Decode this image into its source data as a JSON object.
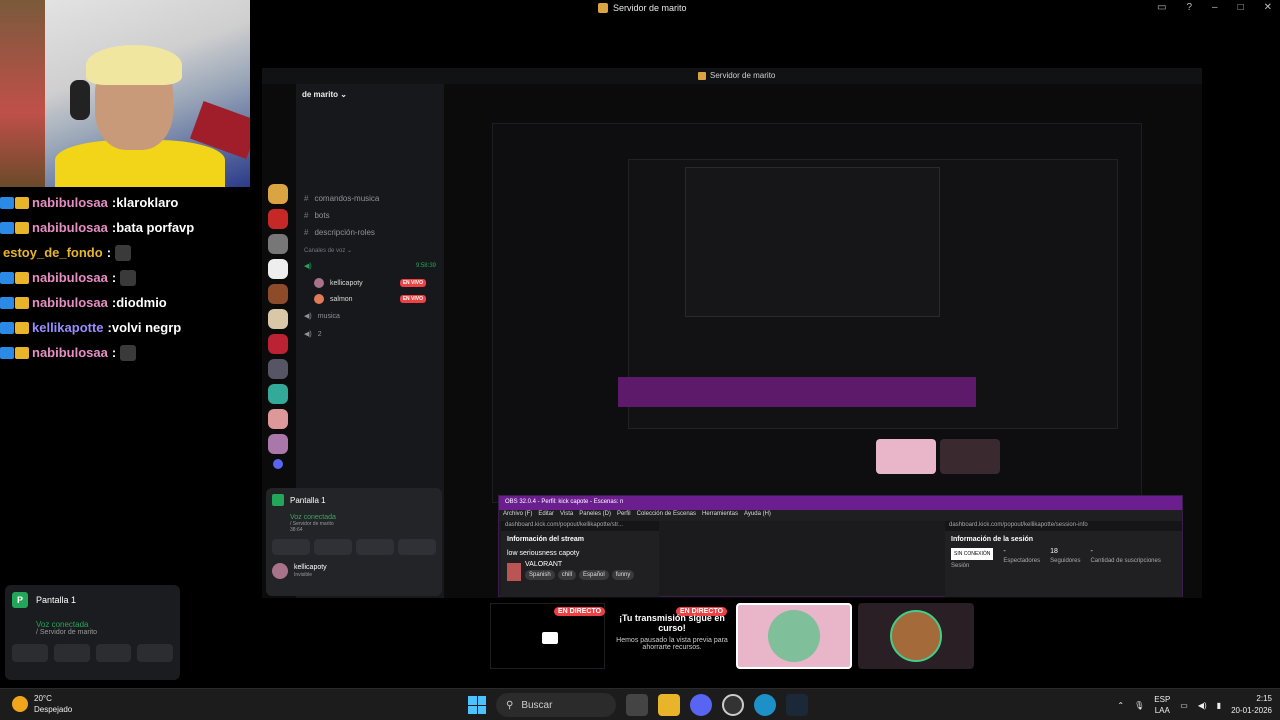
{
  "window": {
    "title": "Servidor de marito"
  },
  "chat": [
    {
      "user": "nabibulosaa",
      "color": "#e88ec4",
      "msg": "klaroklaro",
      "badges": [
        "mod",
        "crown"
      ]
    },
    {
      "user": "nabibulosaa",
      "color": "#e88ec4",
      "msg": "bata porfavp",
      "badges": [
        "mod",
        "crown"
      ]
    },
    {
      "user": "estoy_de_fondo",
      "color": "#e8b52a",
      "msg": "",
      "badges": []
    },
    {
      "user": "nabibulosaa",
      "color": "#e88ec4",
      "msg": "",
      "badges": [
        "mod",
        "crown"
      ]
    },
    {
      "user": "nabibulosaa",
      "color": "#e88ec4",
      "msg": "diodmio",
      "badges": [
        "mod",
        "crown"
      ]
    },
    {
      "user": "kellikapotte",
      "color": "#9b8cff",
      "msg": "volvi negrp",
      "badges": [
        "mod",
        "crown"
      ]
    },
    {
      "user": "nabibulosaa",
      "color": "#e88ec4",
      "msg": "",
      "badges": [
        "mod",
        "crown"
      ]
    }
  ],
  "discord": {
    "window_title": "Servidor de marito",
    "server_header": "de marito",
    "channels": [
      "comandos-musica",
      "bots",
      "descripción-roles"
    ],
    "voice_section": "Canales de voz",
    "voice_channel": "",
    "voice_timer": "9:58:39",
    "voice_users": [
      {
        "name": "kellicapoty",
        "live": "EN VIVO"
      },
      {
        "name": "salmon",
        "live": "EN VIVO"
      }
    ],
    "other_voice": [
      "musica",
      "2"
    ],
    "panel": {
      "title": "Pantalla 1",
      "voice": "Voz conectada",
      "server": "/ Servidor de marito",
      "timer": "38:64",
      "user": "kellicapoty",
      "status": "Invisible"
    }
  },
  "obs": {
    "title": "OBS 32.0.4 - Perfil: kick capote - Escenas: n",
    "menu": [
      "Archivo (F)",
      "Editar",
      "Vista",
      "Paneles (D)",
      "Perfil",
      "Colección de Escenas",
      "Herramientas",
      "Ayuda (H)"
    ],
    "dock1": {
      "url": "dashboard.kick.com/popout/kellikapotte/str...",
      "header": "Información del stream",
      "stream_title": "low seriousness capoty",
      "game": "VALORANT",
      "tags": [
        "Spanish",
        "chill",
        "Español",
        "funny"
      ]
    },
    "dock2": {
      "url": "dashboard.kick.com/popout/kellikapotte/session-info",
      "header": "Información de la sesión",
      "status": "SIN CONEXIÓN",
      "status_label": "Sesión",
      "viewers_value": "-",
      "viewers_label": "Espectadores",
      "followers_value": "18",
      "followers_label": "Seguidores",
      "subs_value": "-",
      "subs_label": "Cantidad de suscripciones"
    }
  },
  "stream_status": {
    "live_label": "EN DIRECTO",
    "paused_title": "¡Tu transmisión sigue en curso!",
    "paused_sub": "Hemos pausado la vista previa para ahorrarte recursos."
  },
  "bottom_panel": {
    "title": "Pantalla 1",
    "voice": "Voz conectada",
    "server": "/ Servidor de marito"
  },
  "taskbar": {
    "temp": "20°C",
    "weather": "Despejado",
    "search": "Buscar",
    "lang1": "ESP",
    "lang2": "LAA",
    "time": "2:15",
    "date": "20-01-2026"
  },
  "colors": {
    "discord_green": "#23a55a",
    "live_red": "#ed4245",
    "obs_purple": "#6b1f8f"
  }
}
